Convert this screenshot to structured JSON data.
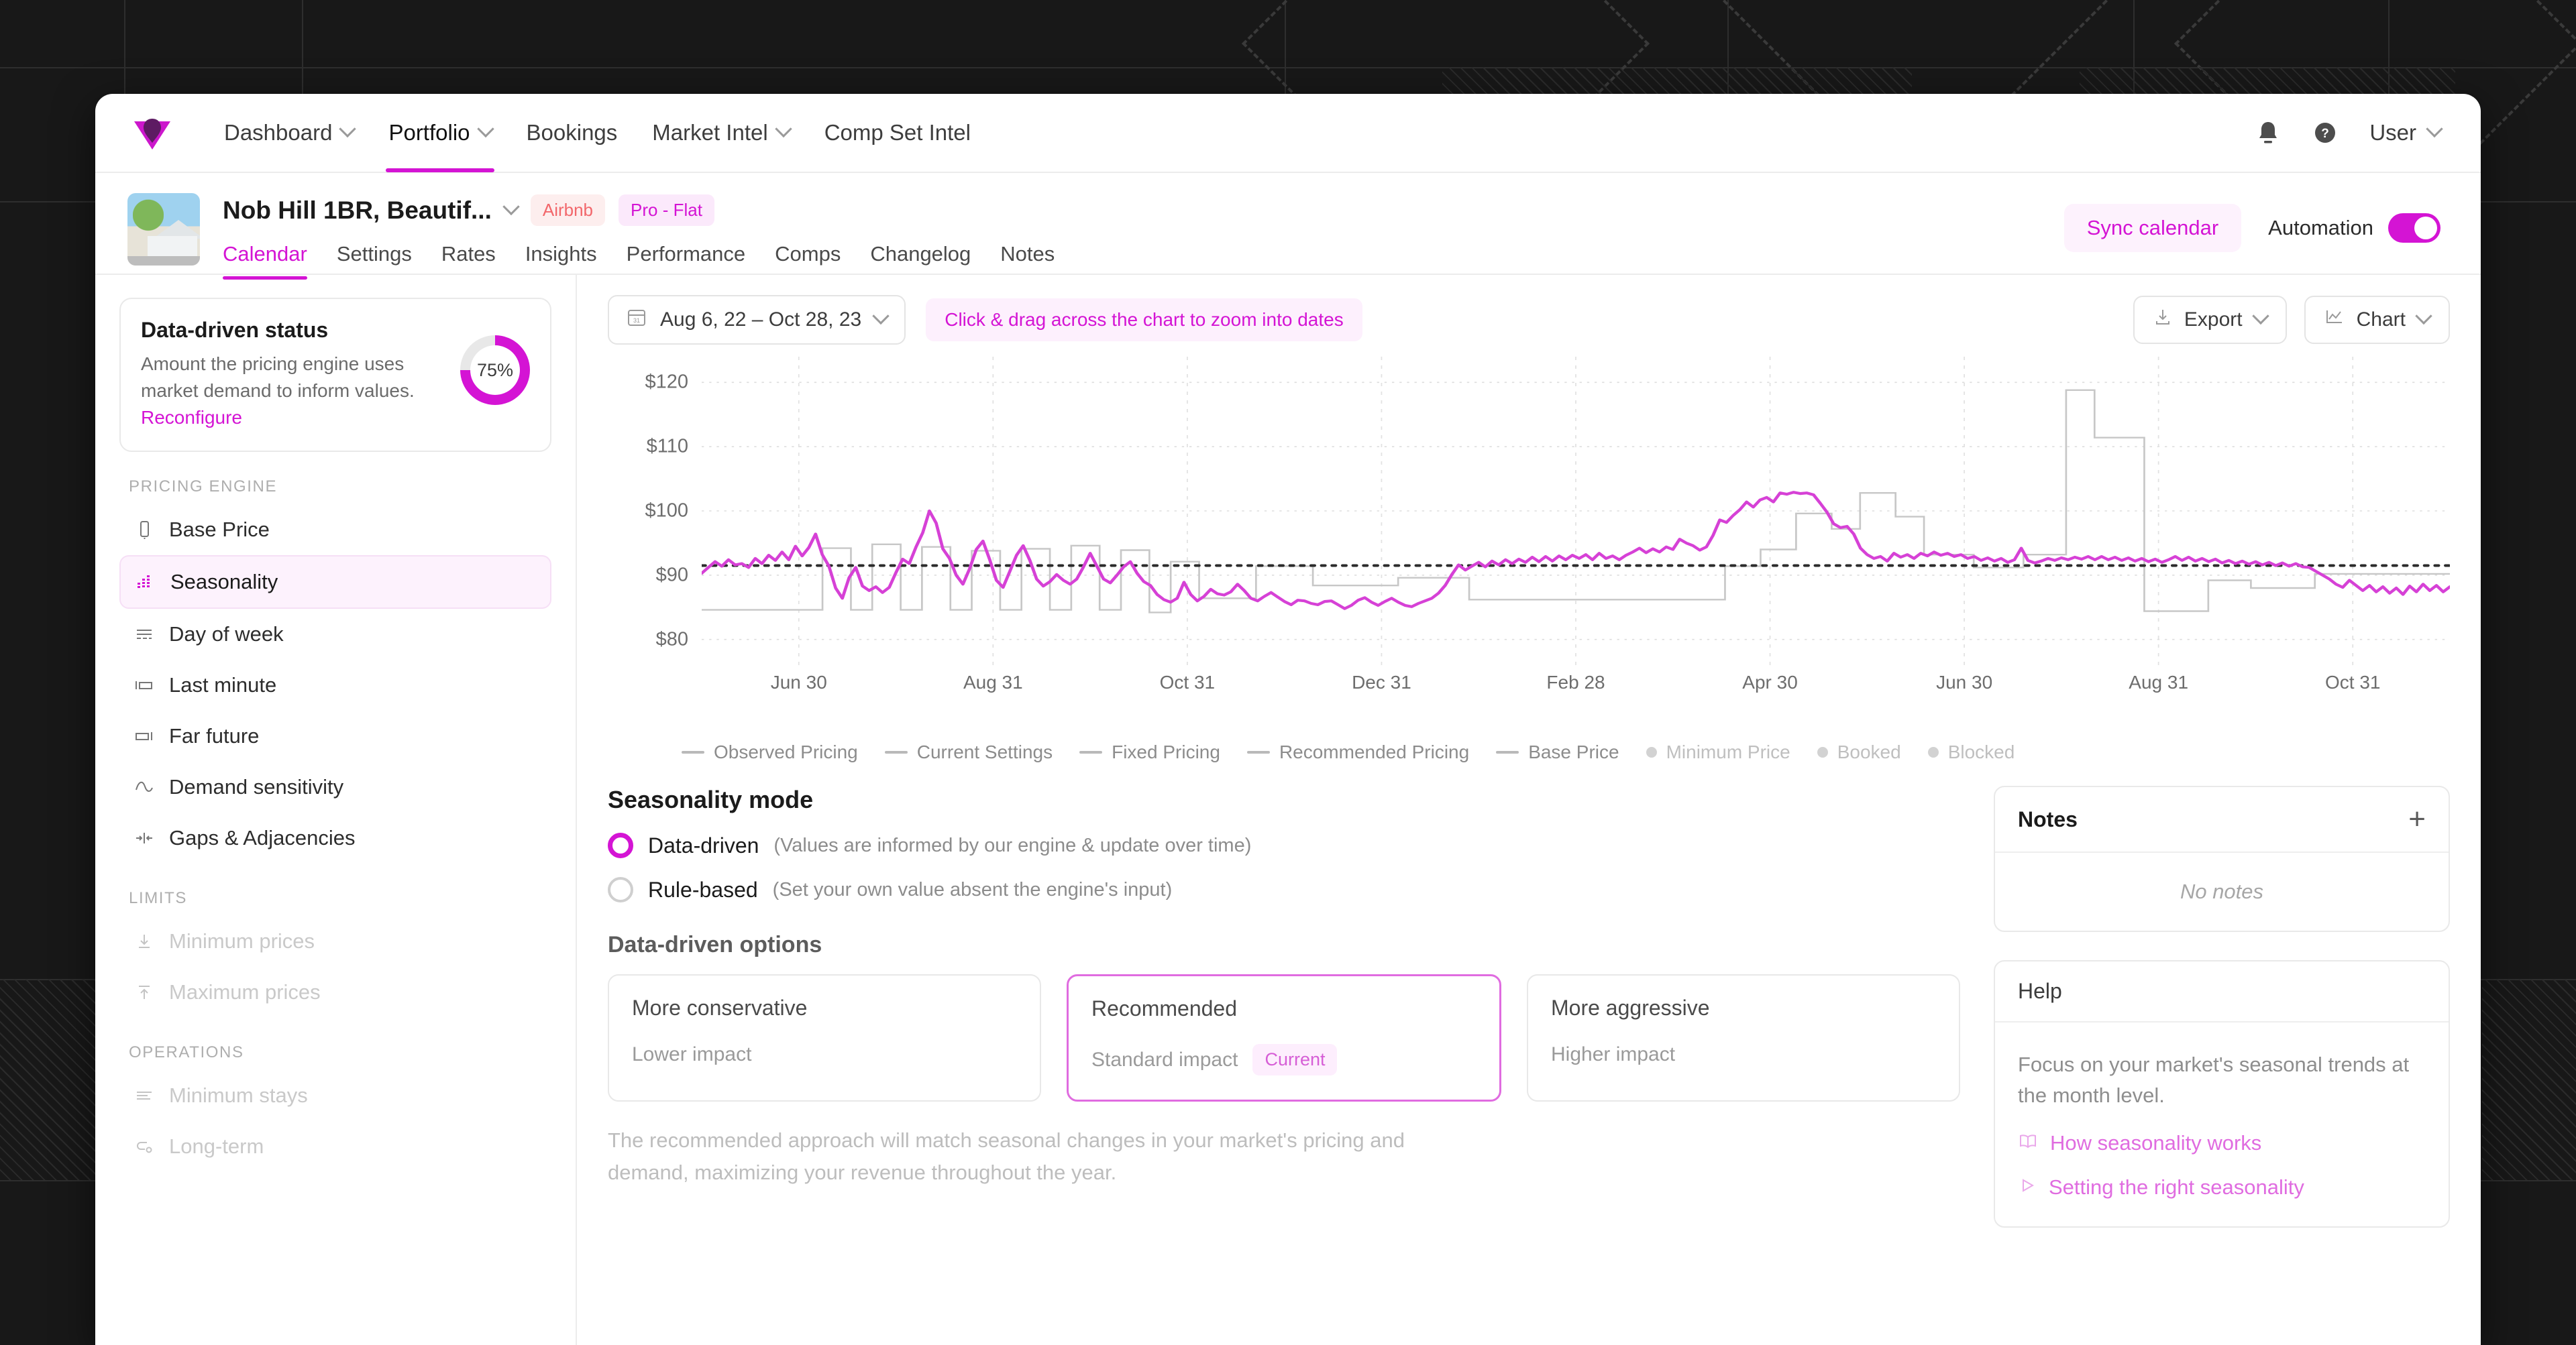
{
  "topnav": {
    "logo_name": "wheelhouse-logo",
    "items": [
      {
        "label": "Dashboard",
        "has_chevron": true,
        "active": false
      },
      {
        "label": "Portfolio",
        "has_chevron": true,
        "active": true
      },
      {
        "label": "Bookings",
        "has_chevron": false,
        "active": false
      },
      {
        "label": "Market Intel",
        "has_chevron": true,
        "active": false
      },
      {
        "label": "Comp Set Intel",
        "has_chevron": false,
        "active": false
      }
    ],
    "notification_icon": "bell-icon",
    "help_icon": "help-circle-icon",
    "user_label": "User"
  },
  "property": {
    "title": "Nob Hill 1BR, Beautif...",
    "badges": [
      {
        "label": "Airbnb",
        "kind": "airbnb"
      },
      {
        "label": "Pro - Flat",
        "kind": "plan"
      }
    ],
    "tabs": [
      {
        "label": "Calendar",
        "active": true
      },
      {
        "label": "Settings",
        "active": false
      },
      {
        "label": "Rates",
        "active": false
      },
      {
        "label": "Insights",
        "active": false
      },
      {
        "label": "Performance",
        "active": false
      },
      {
        "label": "Comps",
        "active": false
      },
      {
        "label": "Changelog",
        "active": false
      },
      {
        "label": "Notes",
        "active": false
      }
    ],
    "sync_label": "Sync calendar",
    "automation_label": "Automation",
    "automation_on": true
  },
  "sidebar": {
    "status": {
      "title": "Data-driven status",
      "description": "Amount the pricing engine uses market demand to inform values. ",
      "link_label": "Reconfigure",
      "percent_label": "75%",
      "percent_value": 75
    },
    "groups": [
      {
        "label": "PRICING ENGINE",
        "items": [
          {
            "label": "Base Price",
            "icon": "price-tag-icon",
            "active": false,
            "muted": false
          },
          {
            "label": "Seasonality",
            "icon": "bar-chart-icon",
            "active": true,
            "muted": false
          },
          {
            "label": "Day of week",
            "icon": "rows-icon",
            "active": false,
            "muted": false
          },
          {
            "label": "Last minute",
            "icon": "calendar-left-icon",
            "active": false,
            "muted": false
          },
          {
            "label": "Far future",
            "icon": "calendar-right-icon",
            "active": false,
            "muted": false
          },
          {
            "label": "Demand sensitivity",
            "icon": "wave-icon",
            "active": false,
            "muted": false
          },
          {
            "label": "Gaps & Adjacencies",
            "icon": "arrows-in-icon",
            "active": false,
            "muted": false
          }
        ]
      },
      {
        "label": "LIMITS",
        "items": [
          {
            "label": "Minimum prices",
            "icon": "arrow-down-line-icon",
            "active": false,
            "muted": true
          },
          {
            "label": "Maximum prices",
            "icon": "arrow-up-line-icon",
            "active": false,
            "muted": true
          }
        ]
      },
      {
        "label": "OPERATIONS",
        "items": [
          {
            "label": "Minimum stays",
            "icon": "lines-icon",
            "active": false,
            "muted": true
          },
          {
            "label": "Long-term",
            "icon": "link-icon",
            "active": false,
            "muted": true
          }
        ]
      }
    ]
  },
  "toolbar": {
    "calendar_icon": "calendar-icon",
    "date_range": "Aug 6, 22 – Oct 28, 23",
    "zoom_hint": "Click & drag across the chart to zoom into dates",
    "export_label": "Export",
    "export_icon": "download-icon",
    "chart_label": "Chart",
    "chart_icon": "line-chart-icon"
  },
  "chart_data": {
    "type": "line",
    "title": "",
    "xlabel": "",
    "ylabel": "",
    "ylim": [
      76,
      124
    ],
    "y_ticks": [
      120,
      110,
      100,
      90,
      80
    ],
    "y_tick_labels": [
      "$120",
      "$110",
      "$100",
      "$90",
      "$80"
    ],
    "x_tick_labels": [
      "Jun 30",
      "Aug 31",
      "Oct 31",
      "Dec 31",
      "Feb 28",
      "Apr 30",
      "Jun 30",
      "Aug 31",
      "Oct 31"
    ],
    "grid": true,
    "legend_position": "bottom",
    "legend": [
      {
        "label": "Observed Pricing",
        "marker": "line",
        "color": "#b9b9b9"
      },
      {
        "label": "Current Settings",
        "marker": "line",
        "color": "#b9b9b9"
      },
      {
        "label": "Fixed Pricing",
        "marker": "line",
        "color": "#b9b9b9"
      },
      {
        "label": "Recommended Pricing",
        "marker": "line",
        "color": "#b9b9b9"
      },
      {
        "label": "Base Price",
        "marker": "line",
        "color": "#b9b9b9"
      },
      {
        "label": "Minimum Price",
        "marker": "dot",
        "color": "#d2d2d2"
      },
      {
        "label": "Booked",
        "marker": "dot",
        "color": "#d2d2d2"
      },
      {
        "label": "Blocked",
        "marker": "dot",
        "color": "#d2d2d2"
      }
    ],
    "base_price": 91.5,
    "series": [
      {
        "name": "Recommended Pricing",
        "color": "#d641d6",
        "values": [
          90.3,
          91.2,
          92.1,
          91.4,
          92.4,
          91.6,
          91.8,
          91.2,
          92.6,
          91.8,
          93.1,
          92.3,
          93.6,
          92.4,
          94.5,
          93.0,
          94.3,
          96.4,
          93.2,
          91.4,
          88.0,
          86.4,
          89.6,
          91.2,
          88.3,
          87.6,
          88.2,
          87.3,
          88.1,
          90.4,
          92.5,
          91.8,
          94.4,
          96.6,
          100.0,
          98.1,
          94.1,
          92.6,
          90.0,
          88.6,
          91.0,
          94.0,
          95.3,
          92.4,
          89.2,
          88.1,
          90.6,
          93.1,
          94.6,
          92.3,
          89.4,
          88.3,
          89.0,
          90.1,
          89.2,
          88.6,
          89.4,
          91.3,
          93.4,
          91.4,
          89.4,
          88.8,
          90.0,
          91.3,
          92.1,
          90.3,
          89.0,
          88.4,
          87.0,
          86.2,
          85.8,
          86.4,
          88.9,
          87.0,
          86.0,
          86.7,
          87.8,
          87.1,
          86.9,
          87.4,
          88.6,
          87.6,
          86.4,
          86.0,
          86.7,
          87.3,
          86.6,
          85.9,
          85.4,
          86.1,
          86.0,
          85.6,
          85.4,
          85.9,
          86.0,
          85.4,
          84.8,
          85.3,
          86.1,
          86.5,
          85.8,
          85.3,
          85.9,
          86.4,
          85.8,
          85.3,
          85.1,
          85.6,
          86.0,
          86.4,
          87.2,
          88.4,
          90.1,
          91.6,
          90.8,
          91.4,
          92.0,
          91.3,
          92.2,
          91.6,
          92.4,
          91.8,
          92.5,
          92.0,
          92.8,
          92.1,
          92.9,
          92.2,
          93.0,
          92.4,
          93.1,
          92.6,
          93.2,
          92.4,
          93.4,
          92.6,
          93.0,
          92.4,
          93.1,
          93.6,
          94.2,
          93.5,
          94.1,
          93.6,
          94.4,
          94.0,
          95.6,
          95.0,
          94.6,
          93.9,
          94.4,
          96.2,
          98.6,
          98.2,
          99.3,
          100.2,
          101.4,
          100.6,
          101.7,
          102.1,
          101.4,
          102.8,
          102.6,
          102.9,
          102.7,
          102.8,
          102.5,
          101.2,
          99.8,
          98.0,
          97.4,
          97.6,
          96.4,
          94.2,
          93.2,
          92.6,
          92.9,
          92.2,
          93.4,
          92.8,
          93.2,
          92.6,
          93.4,
          93.0,
          93.6,
          93.1,
          93.4,
          92.9,
          93.2,
          92.6,
          92.9,
          92.3,
          92.7,
          92.2,
          92.6,
          92.0,
          92.4,
          94.2,
          92.3,
          91.9,
          92.2,
          92.6,
          92.3,
          92.7,
          92.4,
          92.8,
          92.5,
          92.9,
          92.4,
          92.9,
          92.4,
          92.8,
          92.3,
          92.7,
          92.2,
          92.6,
          92.1,
          92.5,
          92.0,
          92.4,
          92.9,
          92.3,
          92.8,
          92.2,
          92.6,
          92.1,
          92.5,
          91.9,
          92.3,
          91.8,
          92.2,
          91.7,
          92.1,
          91.6,
          92.0,
          91.5,
          91.9,
          91.4,
          91.8,
          91.3,
          91.2,
          90.6,
          90.0,
          89.4,
          88.6,
          88.1,
          89.2,
          88.4,
          87.6,
          88.4,
          87.4,
          88.2,
          87.2,
          88.0,
          87.0,
          88.3,
          87.4,
          88.6,
          87.6,
          88.4,
          87.4,
          88.2
        ]
      },
      {
        "name": "Current Settings",
        "color": "#c7c7c7",
        "values": [
          84.6,
          84.6,
          84.6,
          84.6,
          84.6,
          84.6,
          84.6,
          84.6,
          84.6,
          84.6,
          84.6,
          84.6,
          84.6,
          84.6,
          84.6,
          84.6,
          84.6,
          94.2,
          94.2,
          94.2,
          94.2,
          84.6,
          84.6,
          84.6,
          94.8,
          94.8,
          94.8,
          94.8,
          84.6,
          84.6,
          84.6,
          94.4,
          94.4,
          94.4,
          94.4,
          84.6,
          84.6,
          84.6,
          93.8,
          93.8,
          93.8,
          93.8,
          84.6,
          84.6,
          84.6,
          94.1,
          94.1,
          94.1,
          94.1,
          84.6,
          84.6,
          84.6,
          94.6,
          94.6,
          94.6,
          94.6,
          84.6,
          84.6,
          84.6,
          93.9,
          93.9,
          93.9,
          93.9,
          84.2,
          84.2,
          84.2,
          92.1,
          92.1,
          92.1,
          92.1,
          86.4,
          86.4,
          86.4,
          86.4,
          86.4,
          86.4,
          86.4,
          86.4,
          91.4,
          91.4,
          91.4,
          91.4,
          91.4,
          91.4,
          91.4,
          91.4,
          88.4,
          88.4,
          88.4,
          88.4,
          88.4,
          88.4,
          88.4,
          88.4,
          88.4,
          88.4,
          88.4,
          88.4,
          89.6,
          89.6,
          89.6,
          89.6,
          89.6,
          89.6,
          89.6,
          89.6,
          89.6,
          89.6,
          86.2,
          86.2,
          86.2,
          86.2,
          86.2,
          86.2,
          86.2,
          86.2,
          86.2,
          86.2,
          86.2,
          86.2,
          86.2,
          86.2,
          86.2,
          86.2,
          86.2,
          86.2,
          86.2,
          86.2,
          86.2,
          86.2,
          86.2,
          86.2,
          86.2,
          86.2,
          86.2,
          86.2,
          86.2,
          86.2,
          86.2,
          86.2,
          86.2,
          86.2,
          86.2,
          86.2,
          91.4,
          91.4,
          91.4,
          91.4,
          91.4,
          94.0,
          94.0,
          94.0,
          94.0,
          94.0,
          99.6,
          99.6,
          99.6,
          99.6,
          99.6,
          97.2,
          97.2,
          97.2,
          97.2,
          102.8,
          102.8,
          102.8,
          102.8,
          102.8,
          99.1,
          99.1,
          99.1,
          99.1,
          93.2,
          93.2,
          93.2,
          93.2,
          93.2,
          93.2,
          93.2,
          91.2,
          91.2,
          91.2,
          91.2,
          91.2,
          91.2,
          91.2,
          93.2,
          93.2,
          93.2,
          93.2,
          93.2,
          93.2,
          118.8,
          118.8,
          118.8,
          118.8,
          111.4,
          111.4,
          111.4,
          111.4,
          111.4,
          111.4,
          111.4,
          84.4,
          84.4,
          84.4,
          84.4,
          84.4,
          84.4,
          84.4,
          84.4,
          84.4,
          89.2,
          89.2,
          89.2,
          89.2,
          89.2,
          89.2,
          88.0,
          88.0,
          88.0,
          88.0,
          88.0,
          88.0,
          88.0,
          88.0,
          88.0,
          90.2,
          90.2,
          90.2,
          90.2,
          90.2,
          90.2,
          90.2,
          90.2,
          90.2,
          90.2,
          90.2,
          90.2,
          90.2,
          90.2,
          90.2,
          90.2,
          90.2,
          90.2,
          90.2,
          90.2
        ]
      }
    ]
  },
  "seasonality": {
    "mode_title": "Seasonality mode",
    "modes": [
      {
        "label": "Data-driven",
        "help": "(Values are informed by our engine & update over time)",
        "selected": true
      },
      {
        "label": "Rule-based",
        "help": "(Set your own value absent the engine's input)",
        "selected": false
      }
    ],
    "options_title": "Data-driven options",
    "options": [
      {
        "title": "More conservative",
        "sub": "Lower impact",
        "pill": "",
        "selected": false
      },
      {
        "title": "Recommended",
        "sub": "Standard impact",
        "pill": "Current",
        "selected": true
      },
      {
        "title": "More aggressive",
        "sub": "Higher impact",
        "pill": "",
        "selected": false
      }
    ],
    "description": "The recommended approach will match seasonal changes in your market's pricing and demand, maximizing your revenue throughout the year."
  },
  "notes_panel": {
    "title": "Notes",
    "add_icon": "plus-icon",
    "empty_text": "No notes"
  },
  "help_panel": {
    "title": "Help",
    "text": "Focus on your market's seasonal trends at the month level.",
    "links": [
      {
        "label": "How seasonality works",
        "icon": "book-icon"
      },
      {
        "label": "Setting the right seasonality",
        "icon": "play-icon"
      }
    ]
  },
  "colors": {
    "accent": "#d414d4",
    "accent_light": "#e06ce0",
    "accent_bg": "#fdf2fd",
    "series_recommended": "#d641d6",
    "series_current": "#c7c7c7",
    "base_price_line": "#2b2b2b"
  }
}
